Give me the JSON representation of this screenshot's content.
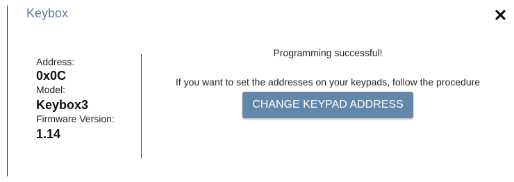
{
  "dialog": {
    "title": "Keybox",
    "close_icon": "close-icon"
  },
  "device_info": {
    "address_label": "Address:",
    "address_value": "0x0C",
    "model_label": "Model:",
    "model_value": "Keybox3",
    "firmware_label": "Firmware Version:",
    "firmware_value": "1.14"
  },
  "main": {
    "status_message": "Programming successful!",
    "hint_message": "If you want to set the addresses on your keypads, follow the procedure",
    "action_button_label": "CHANGE KEYPAD ADDRESS"
  },
  "colors": {
    "title": "#5b7ba0",
    "button_background": "#6386ab",
    "button_text": "#ffffff"
  }
}
